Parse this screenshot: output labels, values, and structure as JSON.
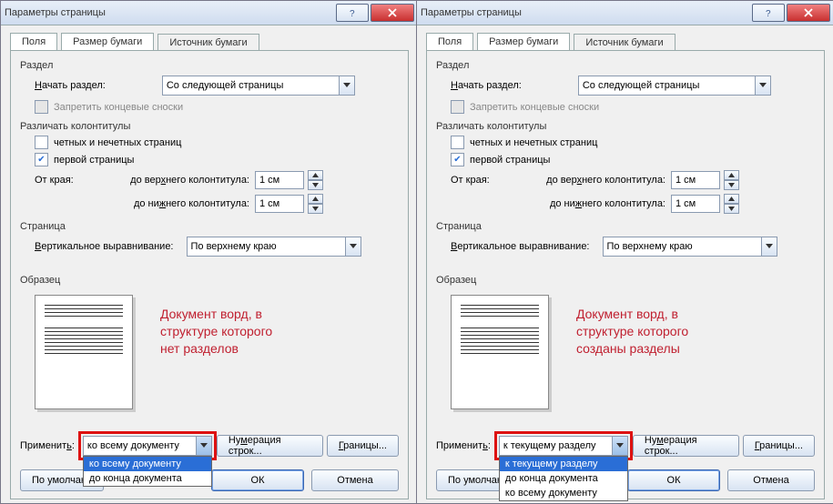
{
  "title": "Параметры страницы",
  "tabs": [
    "Поля",
    "Размер бумаги",
    "Источник бумаги"
  ],
  "section": {
    "razdel": "Раздел",
    "start_label": "Начать раздел:",
    "start_value": "Со следующей страницы",
    "endnotes_label": "Запретить концевые сноски",
    "headers": "Различать колонтитулы",
    "odd_even": "четных и нечетных страниц",
    "first_page": "первой страницы",
    "from_edge": "От края:",
    "header_dist": "до верхнего колонтитула:",
    "footer_dist": "до нижнего колонтитула:",
    "dist_value": "1 см",
    "page": "Страница",
    "valign_label": "Вертикальное выравнивание:",
    "valign_value": "По верхнему краю",
    "preview": "Образец",
    "apply_label": "Применить:",
    "line_numbers": "Нумерация строк...",
    "borders": "Границы...",
    "defaults": "По умолчани",
    "defaults2": "По умолчан",
    "ok": "ОК",
    "cancel": "Отмена"
  },
  "left": {
    "annotation": [
      "Документ ворд, в",
      "структуре которого",
      "нет разделов"
    ],
    "apply_value": "ко всему документу",
    "options": [
      "ко всему документу",
      "до конца документа"
    ],
    "selected_index": 0
  },
  "right": {
    "annotation": [
      "Документ ворд, в",
      "структуре которого",
      "созданы разделы"
    ],
    "apply_value": "к текущему разделу",
    "options": [
      "к текущему разделу",
      "до конца документа",
      "ко всему документу"
    ],
    "selected_index": 0
  }
}
